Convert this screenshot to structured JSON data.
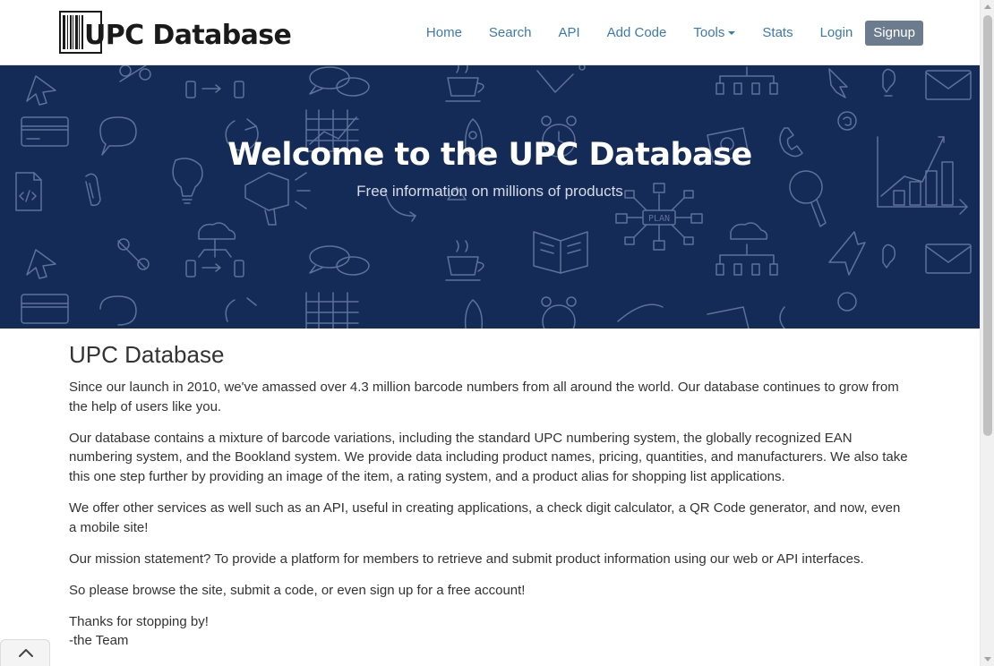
{
  "brand": {
    "name": "UPC Database"
  },
  "nav": {
    "items": [
      {
        "label": "Home"
      },
      {
        "label": "Search"
      },
      {
        "label": "API"
      },
      {
        "label": "Add Code"
      },
      {
        "label": "Tools"
      },
      {
        "label": "Stats"
      },
      {
        "label": "Login"
      }
    ],
    "signup_label": "Signup"
  },
  "hero": {
    "title": "Welcome to the UPC Database",
    "subtitle": "Free information on millions of products",
    "doodle_label": "PLAN"
  },
  "content": {
    "heading": "UPC Database",
    "paragraphs": [
      "Since our launch in 2010, we've amassed over 4.3 million barcode numbers from all around the world. Our database continues to grow from the help of users like you.",
      "Our database contains a mixture of barcode variations, including the standard UPC numbering system, the globally recognized EAN numbering system, and the Bookland system. We provide data including product names, pricing, quantities, and manufacturers. We also take this one step further by providing an image of the item, a rating system, and a product alias for shopping list applications.",
      "We offer other services as well such as an API, useful in creating applications, a check digit calculator, a QR Code generator, and now, even a mobile site!",
      "Our mission statement? To provide a platform for members to retrieve and submit product information using our web or API interfaces.",
      "So please browse the site, submit a code, or even sign up for a free account!"
    ],
    "signoff_1": "Thanks for stopping by!",
    "signoff_2": "-the Team"
  },
  "colors": {
    "hero_bg": "#142a57",
    "nav_link": "#3a7ab3",
    "signup_bg": "#6c7c8e"
  },
  "icons": {
    "back_to_top": "chevron-up-icon"
  }
}
